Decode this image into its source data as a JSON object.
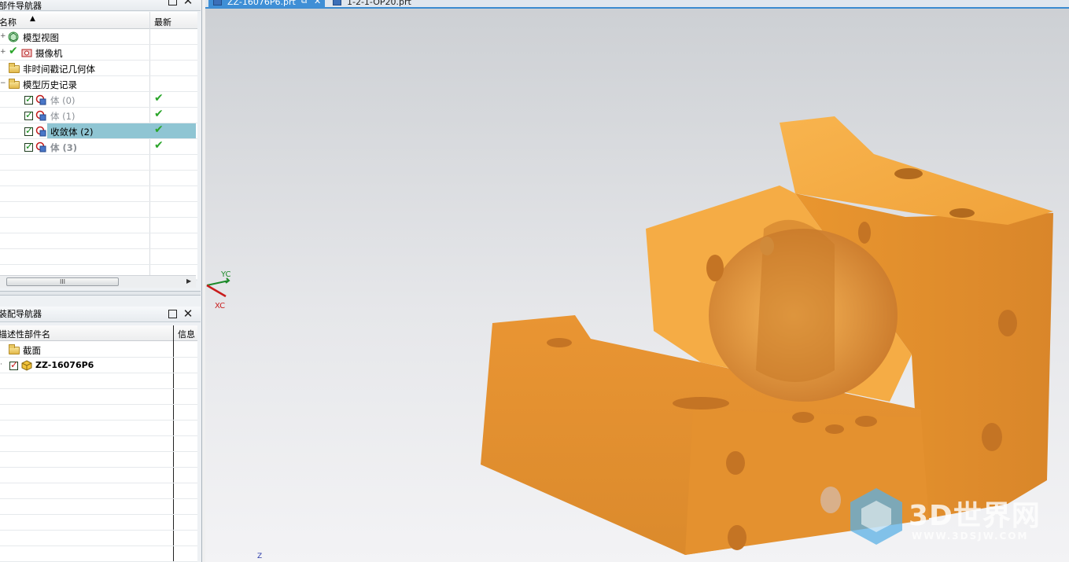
{
  "part_navigator": {
    "title": "部件导航器",
    "col_name": "名称",
    "col_latest": "最新",
    "items": [
      {
        "label": "模型视图"
      },
      {
        "label": "摄像机"
      },
      {
        "label": "非时间戳记几何体"
      },
      {
        "label": "模型历史记录"
      },
      {
        "label": "体 (0)"
      },
      {
        "label": "体 (1)"
      },
      {
        "label": "收敛体 (2)"
      },
      {
        "label": "体 (3)"
      }
    ],
    "scrollbar_grip": "III"
  },
  "assembly_navigator": {
    "title": "装配导航器",
    "col_name": "描述性部件名",
    "col_info": "信息",
    "items": [
      {
        "label": "截面"
      },
      {
        "label": "ZZ-16076P6"
      }
    ]
  },
  "tabs": [
    {
      "label": "ZZ-16076P6.prt"
    },
    {
      "label": "1-2-1-OP20.prt"
    }
  ],
  "axes": {
    "yc": "YC",
    "xc": "XC",
    "z": "Z"
  },
  "watermark": {
    "name": "3D世界网",
    "url": "WWW.3DSJW.COM"
  },
  "colors": {
    "model": "#f2a33a",
    "selection": "#8fc5d3",
    "tab_active": "#3f8fd6"
  }
}
